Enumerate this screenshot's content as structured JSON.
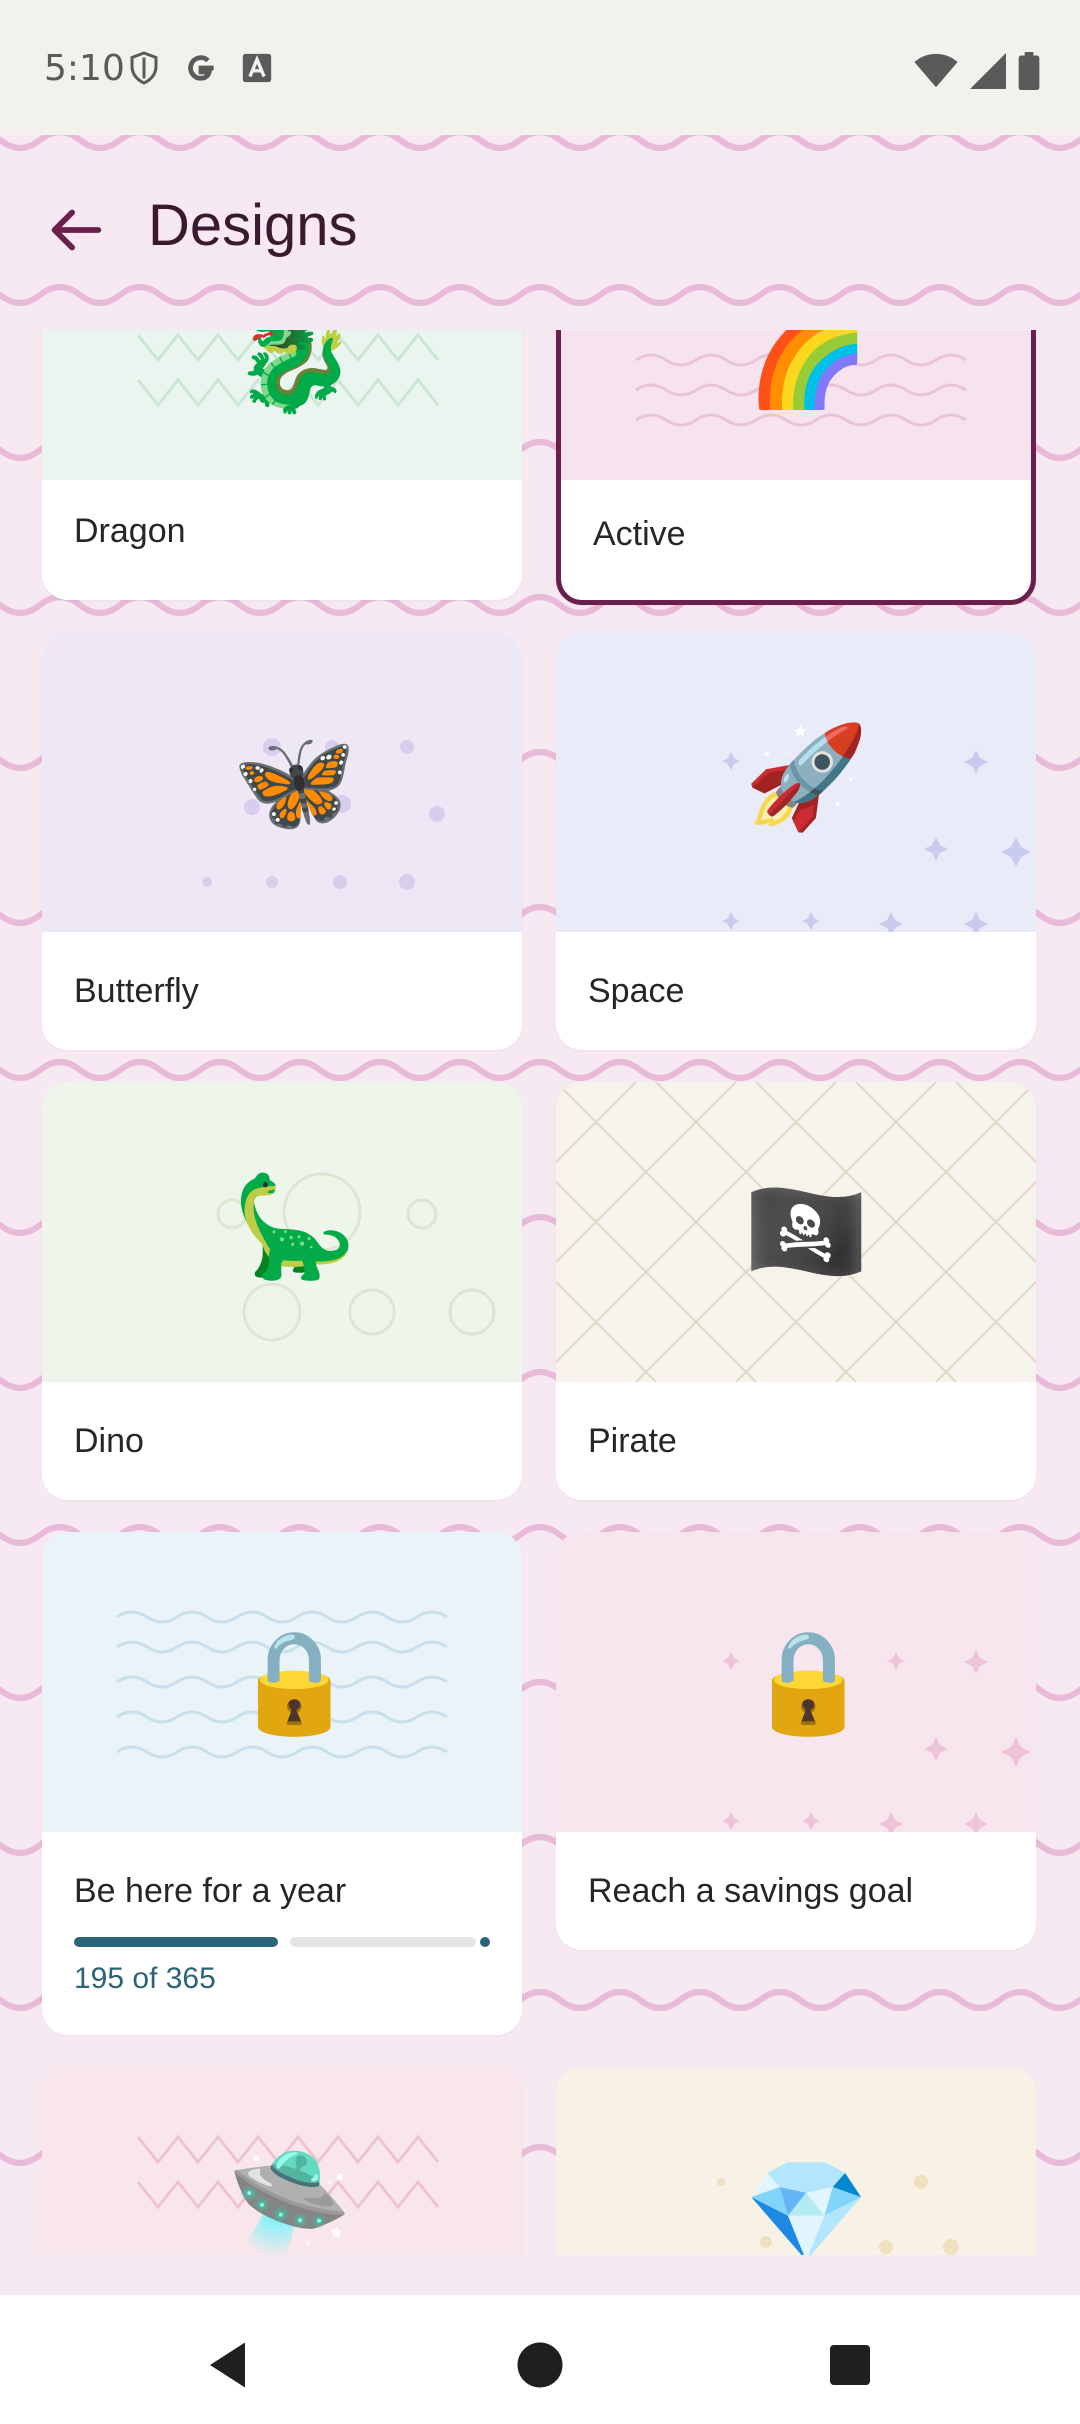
{
  "status": {
    "time": "5:10"
  },
  "appbar": {
    "title": "Designs"
  },
  "cards": [
    {
      "label": "Dragon",
      "icon": "🐉",
      "bg": "#e9f5ee",
      "active": false
    },
    {
      "label": "Active",
      "icon": "🌈",
      "bg": "#f6e3ee",
      "active": true
    },
    {
      "label": "Butterfly",
      "icon": "🦋",
      "bg": "#eee7f6",
      "active": false
    },
    {
      "label": "Space",
      "icon": "🚀",
      "bg": "#eaebf8",
      "active": false
    },
    {
      "label": "Dino",
      "icon": "🦕",
      "bg": "#eef6ec",
      "active": false
    },
    {
      "label": "Pirate",
      "icon": "🏴‍☠️",
      "bg": "#f6f2ec",
      "active": false
    },
    {
      "label": "Be here for a year",
      "icon": "🔒",
      "bg": "#e9f3f8",
      "locked": true,
      "progress": {
        "current": 195,
        "total": 365,
        "text": "195 of 365"
      }
    },
    {
      "label": "Reach a savings goal",
      "icon": "🔒",
      "bg": "#f8e6ef",
      "locked": true
    },
    {
      "label": "",
      "icon": "🛸",
      "bg": "#f8e6ea"
    },
    {
      "label": "",
      "icon": "💎",
      "bg": "#f8f2e6"
    }
  ],
  "colors": {
    "accent": "#6b1f4d",
    "progress": "#2b6478"
  }
}
